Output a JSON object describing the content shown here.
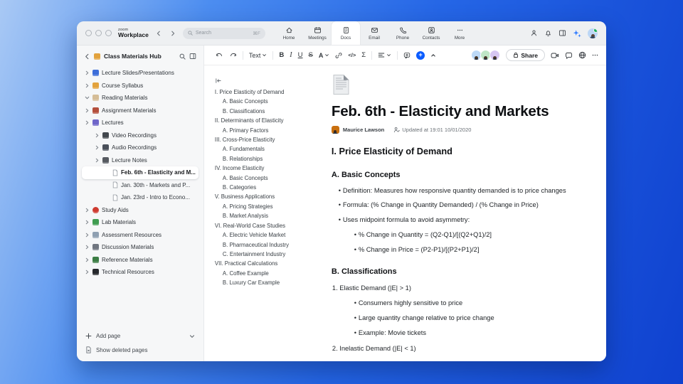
{
  "titlebar": {
    "logo_small": "zoom",
    "logo_big": "Workplace",
    "search_placeholder": "Search",
    "search_shortcut": "⌘F",
    "tabs": [
      {
        "label": "Home",
        "icon": "home-icon",
        "active": false
      },
      {
        "label": "Meetings",
        "icon": "meetings-icon",
        "active": false
      },
      {
        "label": "Docs",
        "icon": "docs-icon",
        "active": true
      },
      {
        "label": "Email",
        "icon": "email-icon",
        "active": false
      },
      {
        "label": "Phone",
        "icon": "phone-icon",
        "active": false
      },
      {
        "label": "Contacts",
        "icon": "contacts-icon",
        "active": false
      },
      {
        "label": "More",
        "icon": "more-icon",
        "active": false
      }
    ]
  },
  "sidebar": {
    "title": "Class Materials Hub",
    "tree": [
      {
        "depth": 0,
        "expandable": true,
        "expanded": false,
        "icon": "slides-icon",
        "label": "Lecture Slides/Presentations"
      },
      {
        "depth": 0,
        "expandable": true,
        "expanded": false,
        "icon": "syllabus-icon",
        "label": "Course Syllabus"
      },
      {
        "depth": 0,
        "expandable": true,
        "expanded": true,
        "icon": "reading-icon",
        "label": "Reading Materials"
      },
      {
        "depth": 0,
        "expandable": true,
        "expanded": false,
        "icon": "assignment-icon",
        "label": "Assignment Materials"
      },
      {
        "depth": 0,
        "expandable": true,
        "expanded": false,
        "icon": "lectures-icon",
        "label": "Lectures"
      },
      {
        "depth": 1,
        "expandable": true,
        "expanded": false,
        "icon": "video-icon",
        "label": "Video Recordings"
      },
      {
        "depth": 1,
        "expandable": true,
        "expanded": false,
        "icon": "audio-icon",
        "label": "Audio Recordings"
      },
      {
        "depth": 1,
        "expandable": true,
        "expanded": false,
        "icon": "notes-icon",
        "label": "Lecture Notes"
      },
      {
        "depth": 2,
        "expandable": false,
        "icon": "page-icon",
        "label": "Feb. 6th - Elasticity and M...",
        "selected": true
      },
      {
        "depth": 2,
        "expandable": false,
        "icon": "page-icon",
        "label": "Jan. 30th - Markets and P..."
      },
      {
        "depth": 2,
        "expandable": false,
        "icon": "page-icon",
        "label": "Jan. 23rd - Intro to Econo..."
      },
      {
        "depth": 0,
        "expandable": true,
        "expanded": false,
        "icon": "study-icon",
        "label": "Study Aids"
      },
      {
        "depth": 0,
        "expandable": true,
        "expanded": false,
        "icon": "lab-icon",
        "label": "Lab Materials"
      },
      {
        "depth": 0,
        "expandable": true,
        "expanded": false,
        "icon": "assessment-icon",
        "label": "Assessment Resources"
      },
      {
        "depth": 0,
        "expandable": true,
        "expanded": false,
        "icon": "discussion-icon",
        "label": "Discussion Materials"
      },
      {
        "depth": 0,
        "expandable": true,
        "expanded": false,
        "icon": "reference-icon",
        "label": "Reference Materials"
      },
      {
        "depth": 0,
        "expandable": true,
        "expanded": false,
        "icon": "technical-icon",
        "label": "Technical Resources"
      }
    ],
    "add_page_label": "Add page",
    "show_deleted_label": "Show deleted pages"
  },
  "toolbar": {
    "text_style_label": "Text",
    "share_label": "Share"
  },
  "toc": {
    "items": [
      {
        "level": 0,
        "label": "I. Price Elasticity of Demand"
      },
      {
        "level": 1,
        "label": "A. Basic Concepts"
      },
      {
        "level": 1,
        "label": "B. Classifications"
      },
      {
        "level": 0,
        "label": "II. Determinants of Elasticity"
      },
      {
        "level": 1,
        "label": "A. Primary Factors"
      },
      {
        "level": 0,
        "label": "III. Cross-Price Elasticity"
      },
      {
        "level": 1,
        "label": "A. Fundamentals"
      },
      {
        "level": 1,
        "label": "B. Relationships"
      },
      {
        "level": 0,
        "label": "IV. Income Elasticity"
      },
      {
        "level": 1,
        "label": "A. Basic Concepts"
      },
      {
        "level": 1,
        "label": "B. Categories"
      },
      {
        "level": 0,
        "label": "V. Business Applications"
      },
      {
        "level": 1,
        "label": "A. Pricing Strategies"
      },
      {
        "level": 1,
        "label": "B. Market Analysis"
      },
      {
        "level": 0,
        "label": "VI. Real-World Case Studies"
      },
      {
        "level": 1,
        "label": "A. Electric Vehicle Market"
      },
      {
        "level": 1,
        "label": "B. Pharmaceutical Industry"
      },
      {
        "level": 1,
        "label": "C. Entertainment Industry"
      },
      {
        "level": 0,
        "label": "VII. Practical Calculations"
      },
      {
        "level": 1,
        "label": "A. Coffee Example"
      },
      {
        "level": 1,
        "label": "B. Luxury Car Example"
      }
    ]
  },
  "doc": {
    "title": "Feb. 6th - Elasticity and Markets",
    "author": "Maurice Lawson",
    "updated": "Updated at 19:01 10/01/2020",
    "blocks": [
      {
        "type": "h2",
        "text": "I. Price Elasticity of Demand"
      },
      {
        "type": "h3",
        "text": "A. Basic Concepts"
      },
      {
        "type": "li1",
        "text": "Definition: Measures how responsive quantity demanded is to price changes"
      },
      {
        "type": "li1",
        "text": "Formula: (% Change in Quantity Demanded) / (% Change in Price)"
      },
      {
        "type": "li1",
        "text": "Uses midpoint formula to avoid asymmetry:"
      },
      {
        "type": "li2",
        "text": "% Change in Quantity = (Q2-Q1)/[(Q2+Q1)/2]"
      },
      {
        "type": "li2",
        "text": "% Change in Price = (P2-P1)/[(P2+P1)/2]"
      },
      {
        "type": "h3",
        "text": "B. Classifications"
      },
      {
        "type": "num",
        "text": "1. Elastic Demand (|E| > 1)"
      },
      {
        "type": "li2",
        "text": "Consumers highly sensitive to price"
      },
      {
        "type": "li2",
        "text": "Large quantity change relative to price change"
      },
      {
        "type": "li2",
        "text": "Example: Movie tickets"
      },
      {
        "type": "num",
        "text": "2. Inelastic Demand (|E| < 1)"
      }
    ]
  },
  "colors": {
    "accent": "#0B5CFF",
    "background_gradient_start": "#A9C9F4",
    "background_gradient_end": "#0F41CF"
  }
}
